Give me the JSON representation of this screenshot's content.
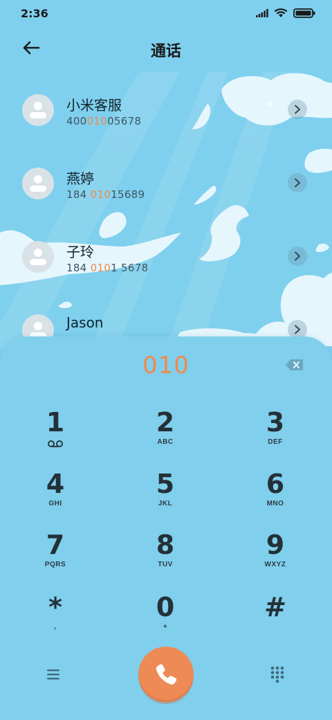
{
  "status": {
    "time": "2:36"
  },
  "header": {
    "title": "通话"
  },
  "contacts": [
    {
      "name": "小米客服",
      "num_pre": "400",
      "num_hl": "010",
      "num_post": "05678"
    },
    {
      "name": "燕婷",
      "num_pre": "184 ",
      "num_hl": "010",
      "num_post": "15689"
    },
    {
      "name": "子玲",
      "num_pre": "184 ",
      "num_hl": "010",
      "num_post": "1 5678"
    },
    {
      "name": "Jason",
      "num_pre": "",
      "num_hl": "",
      "num_post": ""
    }
  ],
  "dialer": {
    "input": "010",
    "keys": [
      {
        "digit": "1",
        "letters": ""
      },
      {
        "digit": "2",
        "letters": "ABC"
      },
      {
        "digit": "3",
        "letters": "DEF"
      },
      {
        "digit": "4",
        "letters": "GHI"
      },
      {
        "digit": "5",
        "letters": "JKL"
      },
      {
        "digit": "6",
        "letters": "MNO"
      },
      {
        "digit": "7",
        "letters": "PQRS"
      },
      {
        "digit": "8",
        "letters": "TUV"
      },
      {
        "digit": "9",
        "letters": "WXYZ"
      },
      {
        "digit": "*",
        "letters": ","
      },
      {
        "digit": "0",
        "letters": "+"
      },
      {
        "digit": "#",
        "letters": ""
      }
    ]
  },
  "icons": {
    "back": "arrow-left-icon",
    "signal": "signal-icon",
    "wifi": "wifi-icon",
    "battery": "battery-icon",
    "voicemail": "voicemail-icon",
    "backspace": "backspace-icon",
    "menu": "menu-icon",
    "call": "phone-icon",
    "keypad": "keypad-icon"
  },
  "colors": {
    "accent": "#f08a4b",
    "call_button": "#ee8a55",
    "background": "#7ccfec"
  }
}
